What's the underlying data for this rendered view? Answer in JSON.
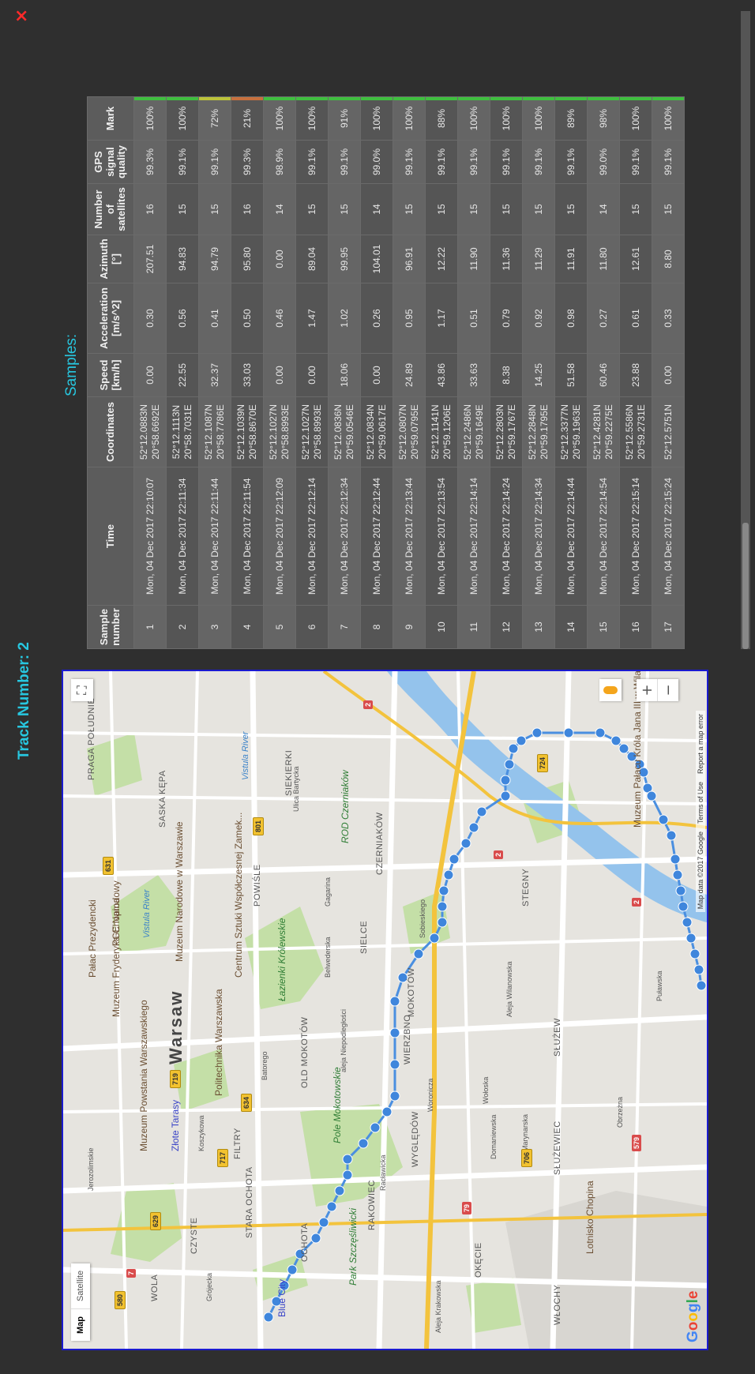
{
  "close_label": "×",
  "track_title": "Track Number: 2",
  "samples_title": "Samples:",
  "map": {
    "type_controls": {
      "map": "Map",
      "satellite": "Satellite"
    },
    "zoom_in": "+",
    "zoom_out": "−",
    "fullscreen": "⛶",
    "logo": "Google",
    "attribution": {
      "data": "Map data ©2017 Google",
      "terms": "Terms of Use",
      "report": "Report a map error"
    },
    "labels": {
      "city": "Warsaw",
      "d1": "PRAGA POŁUDNIE",
      "d2": "SASKA KĘPA",
      "d3": "POWIŚLE",
      "d4": "SIEKIERKI",
      "d5": "CZERNIAKÓW",
      "d6": "SIELCE",
      "d7": "MOKOTÓW",
      "d8": "WIERZBNO",
      "d9": "SŁUŻEW",
      "d10": "STEGNY",
      "d11": "OLD MOKOTÓW",
      "d12": "FILTRY",
      "d13": "STARA OCHOTA",
      "d14": "OCHOTA",
      "d15": "RAKOWIEC",
      "d16": "WYGLĘDÓW",
      "d17": "SŁUŻEWIEC",
      "d18": "OKĘCIE",
      "d19": "WŁOCHY",
      "d20": "CZYSTE",
      "d21": "WOLA",
      "p1": "Łazienki Królewskie",
      "p2": "Pole Mokotowskie",
      "p3": "Park Szczęśliwicki",
      "p4": "ROD Czerniaków",
      "poi1": "Pałac Prezydencki",
      "poi2": "Muzeum Fryderyka Chopina",
      "poi3": "PGE Narodowy",
      "poi4": "Muzeum Narodowe w Warszawie",
      "poi5": "Politechnika Warszawska",
      "poi6": "Muzeum Powstania Warszawskiego",
      "poi7": "Centrum Sztuki Współczesnej Zamek...",
      "poi8": "Muzeum Pałacu Króla Jana III w Wilanowie",
      "poi9": "Lotnisko Chopina",
      "w1": "Vistula River",
      "w2": "Vistula River",
      "t1": "Złote Tarasy",
      "t2": "Blue City",
      "r1": "aleja Niepodległości",
      "r2": "Wołoska",
      "r3": "Puławska",
      "r4": "Sobieskiego",
      "r5": "Belwederska",
      "r6": "Batorego",
      "r7": "Grójecka",
      "r8": "Koszykowa",
      "r9": "Woronicza",
      "r10": "Racławicka",
      "r11": "Domaniewska",
      "r12": "Aleja Wilanowska",
      "r13": "Marynarska",
      "r14": "Obrzeżna",
      "r15": "Ulica Bartycka",
      "r16": "Gagarina",
      "r17": "Jerozolimskie",
      "r18": "Aleja Krakowska",
      "s1": "631",
      "s2": "801",
      "s3": "719",
      "s4": "629",
      "s5": "634",
      "s6": "717",
      "s7": "580",
      "s8": "724",
      "s9": "706",
      "s10": "579",
      "s11": "2",
      "s12": "79",
      "s13": "7",
      "s14": "2",
      "s15": "2"
    }
  },
  "table": {
    "headers": [
      "Sample number",
      "Time",
      "Coordinates",
      "Speed [km/h]",
      "Acceleration [m/s^2]",
      "Azimuth [°]",
      "Number of satellites",
      "GPS signal quality",
      "Mark"
    ],
    "colors": {
      "green": "#3fbf3f",
      "yellow": "#bcc33a",
      "orange": "#c7703d"
    },
    "rows": [
      {
        "n": "1",
        "time": "Mon, 04 Dec 2017 22:10:07",
        "lat": "52°12.0883N",
        "lon": "20°58.6692E",
        "speed": "0.00",
        "acc": "0.30",
        "az": "207.51",
        "sats": "16",
        "q": "99.3%",
        "mark": "100%",
        "color": "green"
      },
      {
        "n": "2",
        "time": "Mon, 04 Dec 2017 22:11:34",
        "lat": "52°12.1113N",
        "lon": "20°58.7031E",
        "speed": "22.55",
        "acc": "0.56",
        "az": "94.83",
        "sats": "15",
        "q": "99.1%",
        "mark": "100%",
        "color": "green"
      },
      {
        "n": "3",
        "time": "Mon, 04 Dec 2017 22:11:44",
        "lat": "52°12.1087N",
        "lon": "20°58.7786E",
        "speed": "32.37",
        "acc": "0.41",
        "az": "94.79",
        "sats": "15",
        "q": "99.1%",
        "mark": "72%",
        "color": "yellow"
      },
      {
        "n": "4",
        "time": "Mon, 04 Dec 2017 22:11:54",
        "lat": "52°12.1039N",
        "lon": "20°58.8670E",
        "speed": "33.03",
        "acc": "0.50",
        "az": "95.80",
        "sats": "16",
        "q": "99.3%",
        "mark": "21%",
        "color": "orange"
      },
      {
        "n": "5",
        "time": "Mon, 04 Dec 2017 22:12:09",
        "lat": "52°12.1027N",
        "lon": "20°58.8993E",
        "speed": "0.00",
        "acc": "0.46",
        "az": "0.00",
        "sats": "14",
        "q": "98.9%",
        "mark": "100%",
        "color": "green"
      },
      {
        "n": "6",
        "time": "Mon, 04 Dec 2017 22:12:14",
        "lat": "52°12.1027N",
        "lon": "20°58.8993E",
        "speed": "0.00",
        "acc": "1.47",
        "az": "89.04",
        "sats": "15",
        "q": "99.1%",
        "mark": "100%",
        "color": "green"
      },
      {
        "n": "7",
        "time": "Mon, 04 Dec 2017 22:12:34",
        "lat": "52°12.0836N",
        "lon": "20°59.0546E",
        "speed": "18.06",
        "acc": "1.02",
        "az": "99.95",
        "sats": "15",
        "q": "99.1%",
        "mark": "91%",
        "color": "green"
      },
      {
        "n": "8",
        "time": "Mon, 04 Dec 2017 22:12:44",
        "lat": "52°12.0834N",
        "lon": "20°59.0617E",
        "speed": "0.00",
        "acc": "0.26",
        "az": "104.01",
        "sats": "14",
        "q": "99.0%",
        "mark": "100%",
        "color": "green"
      },
      {
        "n": "9",
        "time": "Mon, 04 Dec 2017 22:13:44",
        "lat": "52°12.0807N",
        "lon": "20°59.0795E",
        "speed": "24.89",
        "acc": "0.95",
        "az": "96.91",
        "sats": "15",
        "q": "99.1%",
        "mark": "100%",
        "color": "green"
      },
      {
        "n": "10",
        "time": "Mon, 04 Dec 2017 22:13:54",
        "lat": "52°12.1141N",
        "lon": "20°59.1206E",
        "speed": "43.86",
        "acc": "1.17",
        "az": "12.22",
        "sats": "15",
        "q": "99.1%",
        "mark": "88%",
        "color": "green"
      },
      {
        "n": "11",
        "time": "Mon, 04 Dec 2017 22:14:14",
        "lat": "52°12.2486N",
        "lon": "20°59.1649E",
        "speed": "33.63",
        "acc": "0.51",
        "az": "11.90",
        "sats": "15",
        "q": "99.1%",
        "mark": "100%",
        "color": "green"
      },
      {
        "n": "12",
        "time": "Mon, 04 Dec 2017 22:14:24",
        "lat": "52°12.2803N",
        "lon": "20°59.1767E",
        "speed": "8.38",
        "acc": "0.79",
        "az": "11.36",
        "sats": "15",
        "q": "99.1%",
        "mark": "100%",
        "color": "green"
      },
      {
        "n": "13",
        "time": "Mon, 04 Dec 2017 22:14:34",
        "lat": "52°12.2848N",
        "lon": "20°59.1795E",
        "speed": "14.25",
        "acc": "0.92",
        "az": "11.29",
        "sats": "15",
        "q": "99.1%",
        "mark": "100%",
        "color": "green"
      },
      {
        "n": "14",
        "time": "Mon, 04 Dec 2017 22:14:44",
        "lat": "52°12.3377N",
        "lon": "20°59.1963E",
        "speed": "51.58",
        "acc": "0.98",
        "az": "11.91",
        "sats": "15",
        "q": "99.1%",
        "mark": "89%",
        "color": "green"
      },
      {
        "n": "15",
        "time": "Mon, 04 Dec 2017 22:14:54",
        "lat": "52°12.4281N",
        "lon": "20°59.2275E",
        "speed": "60.46",
        "acc": "0.27",
        "az": "11.80",
        "sats": "14",
        "q": "99.0%",
        "mark": "98%",
        "color": "green"
      },
      {
        "n": "16",
        "time": "Mon, 04 Dec 2017 22:15:14",
        "lat": "52°12.5586N",
        "lon": "20°59.2731E",
        "speed": "23.88",
        "acc": "0.61",
        "az": "12.61",
        "sats": "15",
        "q": "99.1%",
        "mark": "100%",
        "color": "green"
      },
      {
        "n": "17",
        "time": "Mon, 04 Dec 2017 22:15:24",
        "lat": "52°12.5751N",
        "lon": "",
        "speed": "0.00",
        "acc": "0.33",
        "az": "8.80",
        "sats": "15",
        "q": "99.1%",
        "mark": "100%",
        "color": "green"
      }
    ]
  }
}
